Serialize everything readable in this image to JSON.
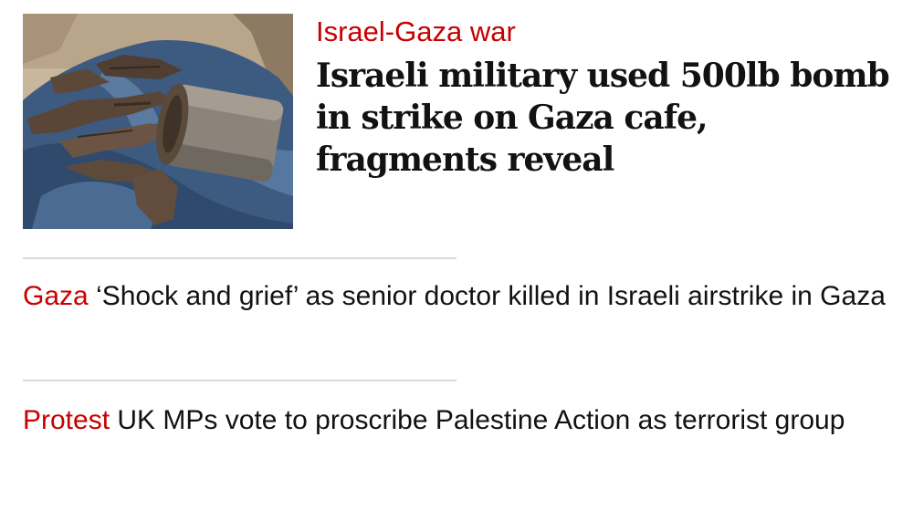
{
  "lead": {
    "kicker": "Israel-Gaza war",
    "headline": "Israeli military used 500lb bomb in strike on Gaza cafe, fragments reveal"
  },
  "stories": [
    {
      "kicker": "Gaza",
      "headline": "‘Shock and grief’ as senior doctor killed in Israeli airstrike in Gaza"
    },
    {
      "kicker": "Protest",
      "headline": "UK MPs vote to proscribe Palestine Action as terrorist group"
    }
  ],
  "colors": {
    "kicker": "#c70000",
    "headline": "#121212",
    "divider": "#d9d9d9",
    "background": "#ffffff"
  }
}
